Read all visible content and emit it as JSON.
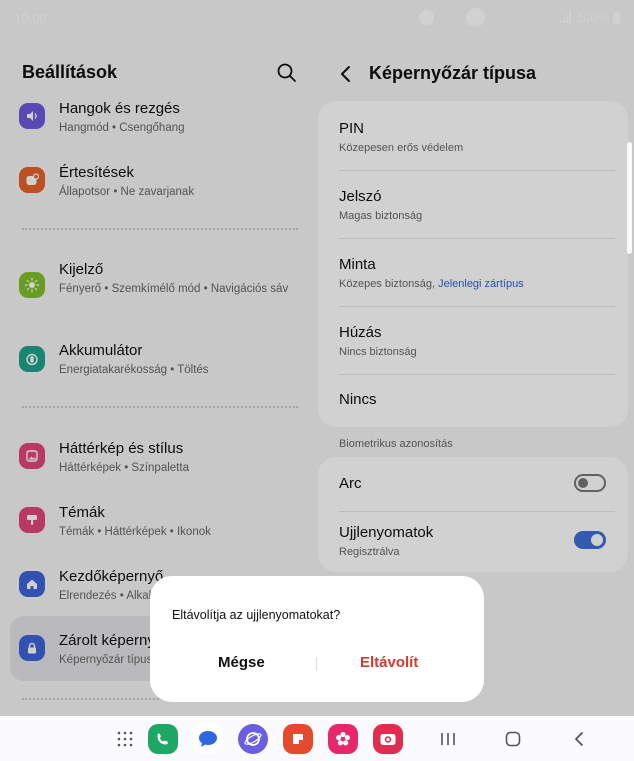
{
  "status_bar": {
    "time": "10:00",
    "battery": "100%"
  },
  "left": {
    "title": "Beállítások",
    "items": [
      {
        "title": "Hangok és rezgés",
        "subtitle": "Hangmód • Csengőhang",
        "icon": "volume-icon",
        "color": "#6b59d8"
      },
      {
        "title": "Értesítések",
        "subtitle": "Állapotsor • Ne zavarjanak",
        "icon": "notification-icon",
        "color": "#e4622a"
      },
      {
        "title": "Kijelző",
        "subtitle": "Fényerő • Szemkímélő mód • Navigációs sáv",
        "icon": "brightness-icon",
        "color": "#7fbf2a"
      },
      {
        "title": "Akkumulátor",
        "subtitle": "Energiatakarékosság • Töltés",
        "icon": "battery-icon",
        "color": "#1fa38a"
      },
      {
        "title": "Háttérkép és stílus",
        "subtitle": "Háttérképek • Színpaletta",
        "icon": "wallpaper-icon",
        "color": "#e0467a"
      },
      {
        "title": "Témák",
        "subtitle": "Témák • Háttérképek • Ikonok",
        "icon": "themes-icon",
        "color": "#e0467a"
      },
      {
        "title": "Kezdőképernyő",
        "subtitle": "Elrendezés • Alkalmazásikon jelvények",
        "icon": "home-icon",
        "color": "#3f63d8"
      },
      {
        "title": "Zárolt képernyő",
        "subtitle": "Képernyőzár típusa • Always On Display",
        "icon": "lock-icon",
        "color": "#3f63d8"
      }
    ]
  },
  "right": {
    "title": "Képernyőzár típusa",
    "options": [
      {
        "title": "PIN",
        "subtitle": "Közepesen erős védelem"
      },
      {
        "title": "Jelszó",
        "subtitle": "Magas biztonság"
      },
      {
        "title": "Minta",
        "subtitle": "Közepes biztonság,",
        "link": "Jelenlegi zártípus"
      },
      {
        "title": "Húzás",
        "subtitle": "Nincs biztonság"
      },
      {
        "title": "Nincs"
      }
    ],
    "biometric_label": "Biometrikus azonosítás",
    "biometrics": [
      {
        "title": "Arc",
        "enabled": false
      },
      {
        "title": "Ujjlenyomatok",
        "subtitle": "Regisztrálva",
        "enabled": true
      }
    ]
  },
  "dialog": {
    "message": "Eltávolítja az ujjlenyomatokat?",
    "cancel_label": "Mégse",
    "confirm_label": "Eltávolít",
    "confirm_color": "#d23b2e"
  },
  "accent_color": "#3e6fd6",
  "nav": {
    "dock": [
      "apps-grid-icon",
      "phone-icon",
      "messages-icon",
      "internet-icon",
      "notes-icon",
      "gallery-icon",
      "camera-icon"
    ],
    "buttons": [
      "recents-icon",
      "home-icon",
      "back-icon"
    ]
  }
}
